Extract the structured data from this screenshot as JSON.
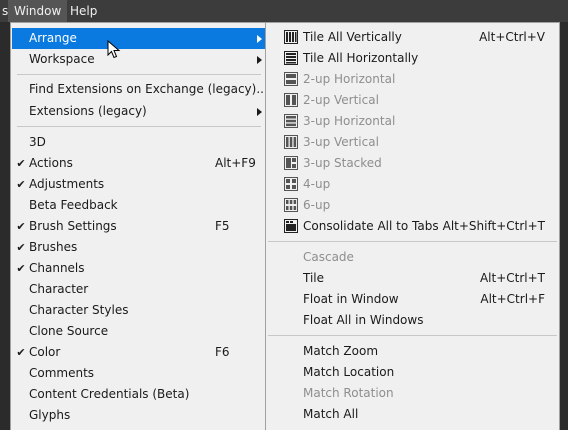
{
  "menubar": {
    "items": [
      {
        "label": "s",
        "active": false
      },
      {
        "label": "Window",
        "active": true
      },
      {
        "label": "Help",
        "active": false
      }
    ]
  },
  "window_menu": {
    "items": [
      {
        "label": "Arrange",
        "submenu": true,
        "highlighted": true
      },
      {
        "label": "Workspace",
        "submenu": true
      },
      {
        "separator": true
      },
      {
        "label": "Find Extensions on Exchange (legacy)..."
      },
      {
        "label": "Extensions (legacy)",
        "submenu": true
      },
      {
        "separator": true
      },
      {
        "label": "3D"
      },
      {
        "label": "Actions",
        "checked": true,
        "shortcut": "Alt+F9"
      },
      {
        "label": "Adjustments",
        "checked": true
      },
      {
        "label": "Beta Feedback"
      },
      {
        "label": "Brush Settings",
        "checked": true,
        "shortcut": "F5"
      },
      {
        "label": "Brushes",
        "checked": true
      },
      {
        "label": "Channels",
        "checked": true
      },
      {
        "label": "Character"
      },
      {
        "label": "Character Styles"
      },
      {
        "label": "Clone Source"
      },
      {
        "label": "Color",
        "checked": true,
        "shortcut": "F6"
      },
      {
        "label": "Comments"
      },
      {
        "label": "Content Credentials (Beta)"
      },
      {
        "label": "Glyphs"
      }
    ]
  },
  "arrange_menu": {
    "items": [
      {
        "label": "Tile All Vertically",
        "icon": "tile-vertical-icon",
        "shortcut": "Alt+Ctrl+V"
      },
      {
        "label": "Tile All Horizontally",
        "icon": "tile-horizontal-icon"
      },
      {
        "label": "2-up Horizontal",
        "icon": "2up-horizontal-icon",
        "disabled": true
      },
      {
        "label": "2-up Vertical",
        "icon": "2up-vertical-icon",
        "disabled": true
      },
      {
        "label": "3-up Horizontal",
        "icon": "3up-horizontal-icon",
        "disabled": true
      },
      {
        "label": "3-up Vertical",
        "icon": "3up-vertical-icon",
        "disabled": true
      },
      {
        "label": "3-up Stacked",
        "icon": "3up-stacked-icon",
        "disabled": true
      },
      {
        "label": "4-up",
        "icon": "4up-icon",
        "disabled": true
      },
      {
        "label": "6-up",
        "icon": "6up-icon",
        "disabled": true
      },
      {
        "label": "Consolidate All to Tabs",
        "icon": "consolidate-tabs-icon",
        "shortcut": "Alt+Shift+Ctrl+T"
      },
      {
        "separator": true
      },
      {
        "label": "Cascade",
        "disabled": true
      },
      {
        "label": "Tile",
        "shortcut": "Alt+Ctrl+T"
      },
      {
        "label": "Float in Window",
        "shortcut": "Alt+Ctrl+F"
      },
      {
        "label": "Float All in Windows"
      },
      {
        "separator": true
      },
      {
        "label": "Match Zoom"
      },
      {
        "label": "Match Location"
      },
      {
        "label": "Match Rotation",
        "disabled": true
      },
      {
        "label": "Match All"
      }
    ]
  },
  "colors": {
    "menubar_bg": "#3c3c3c",
    "menu_bg": "#f0f0f0",
    "highlight": "#0a7ae0",
    "disabled_text": "#8e8e8e"
  },
  "cursor_icon": "pointer-cursor-icon"
}
